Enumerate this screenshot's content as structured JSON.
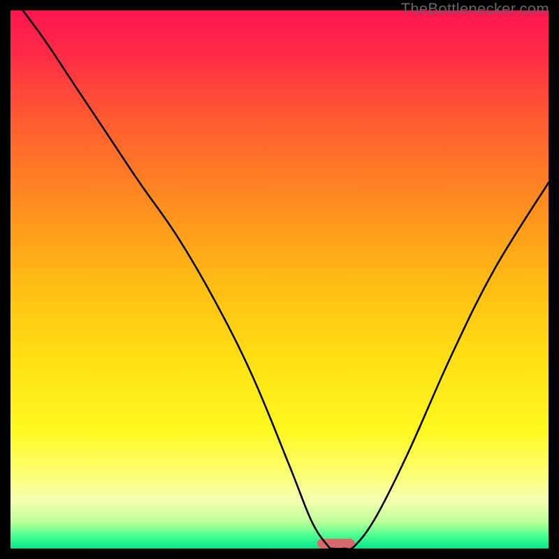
{
  "credit_text": "TheBottlenecker.com",
  "chart_data": {
    "type": "line",
    "title": "",
    "xlabel": "",
    "ylabel": "",
    "xlim": [
      0,
      100
    ],
    "ylim": [
      0,
      100
    ],
    "grid": false,
    "background_gradient": [
      {
        "stop": 0.0,
        "color": "#ff1450"
      },
      {
        "stop": 0.08,
        "color": "#ff2a47"
      },
      {
        "stop": 0.2,
        "color": "#ff5a30"
      },
      {
        "stop": 0.35,
        "color": "#ff8a20"
      },
      {
        "stop": 0.5,
        "color": "#ffba14"
      },
      {
        "stop": 0.65,
        "color": "#ffe014"
      },
      {
        "stop": 0.78,
        "color": "#fff820"
      },
      {
        "stop": 0.86,
        "color": "#fdff70"
      },
      {
        "stop": 0.91,
        "color": "#f5ffb0"
      },
      {
        "stop": 0.95,
        "color": "#c0ff9a"
      },
      {
        "stop": 0.975,
        "color": "#50ff90"
      },
      {
        "stop": 1.0,
        "color": "#00e88a"
      }
    ],
    "series": [
      {
        "name": "bottleneck-curve",
        "x": [
          0,
          6,
          12,
          18,
          24,
          31,
          38,
          45,
          52,
          56,
          59,
          60,
          62,
          64,
          68,
          74,
          82,
          90,
          100
        ],
        "y": [
          103,
          95,
          86,
          77,
          68,
          58,
          46,
          32,
          15,
          5,
          0.5,
          0,
          0,
          0.5,
          6,
          18,
          36,
          52,
          68
        ]
      }
    ],
    "marker": {
      "name": "optimal-range",
      "x_start": 57,
      "x_end": 64,
      "y": 0,
      "color": "#d66a6a"
    }
  }
}
